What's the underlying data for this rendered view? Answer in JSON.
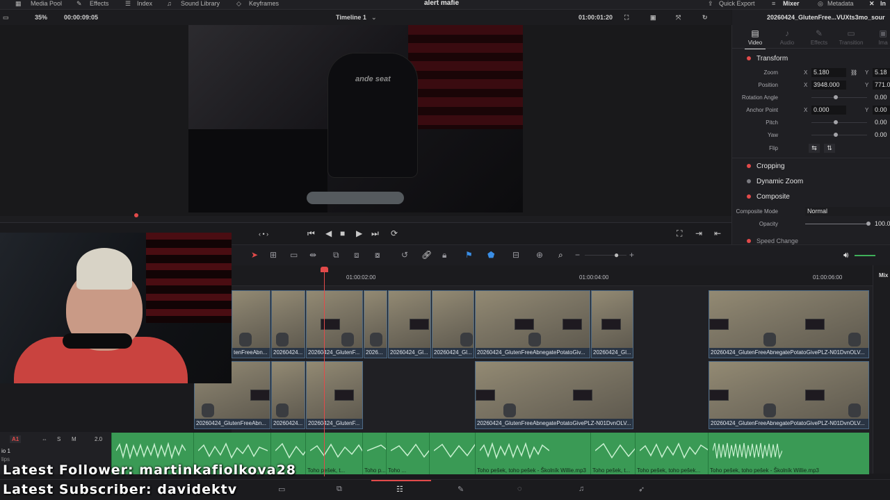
{
  "topbar": {
    "media_pool": "Media Pool",
    "effects": "Effects",
    "index": "Index",
    "sound_library": "Sound Library",
    "keyframes": "Keyframes",
    "project_title": "alert mafie",
    "quick_export": "Quick Export",
    "mixer": "Mixer",
    "metadata": "Metadata",
    "inspector_abbrev": "In"
  },
  "viewer_bar": {
    "zoom": "35%",
    "source_timecode": "00:00:09:05",
    "timeline_name": "Timeline 1",
    "record_timecode": "01:00:01:20"
  },
  "inspector": {
    "clip_name": "20260424_GlutenFree...VUXts3mo_sour",
    "tabs": [
      {
        "label": "Video",
        "icon": "video-icon",
        "active": true
      },
      {
        "label": "Audio",
        "icon": "audio-icon",
        "active": false
      },
      {
        "label": "Effects",
        "icon": "effects-icon",
        "active": false
      },
      {
        "label": "Transition",
        "icon": "transition-icon",
        "active": false
      },
      {
        "label": "Ima",
        "icon": "image-icon",
        "active": false
      }
    ],
    "transform_label": "Transform",
    "zoom_label": "Zoom",
    "zoom_x": "5.180",
    "zoom_y": "5.18",
    "position_label": "Position",
    "position_x": "3948.000",
    "position_y": "771.0",
    "rotation_label": "Rotation Angle",
    "rotation_val": "0.00",
    "anchor_label": "Anchor Point",
    "anchor_x": "0.000",
    "anchor_y": "0.00",
    "pitch_label": "Pitch",
    "pitch_val": "0.00",
    "yaw_label": "Yaw",
    "yaw_val": "0.00",
    "flip_label": "Flip",
    "axis_x": "X",
    "axis_y": "Y",
    "cropping_label": "Cropping",
    "dynamic_zoom_label": "Dynamic Zoom",
    "composite_label": "Composite",
    "composite_mode_label": "Composite Mode",
    "composite_mode_val": "Normal",
    "opacity_label": "Opacity",
    "opacity_val": "100.0",
    "speed_change_label": "Speed Change"
  },
  "timeline": {
    "ruler_labels": [
      "01:00:02:00",
      "01:00:04:00",
      "01:00:06:00"
    ],
    "v2_clips": [
      "tenFreeAbn...",
      "20260424...",
      "20260424_GlutenF...",
      "2026...",
      "20260424_Gl...",
      "20260424_Gl...",
      "20260424_GlutenFreeAbnegatePotatoGiv...",
      "20260424_Gl...",
      "20260424_GlutenFreeAbnegatePotatoGivePLZ-N01DvnOLV..."
    ],
    "v1_clips": [
      "20260424_GlutenFreeAbn...",
      "20260424...",
      "20260424_GlutenF...",
      "20260424_GlutenFreeAbnegatePotatoGivePLZ-N01DvnOLV...",
      "20260424_GlutenFreeAbnegatePotatoGivePLZ-N01DvnOLV..."
    ],
    "audio_clips": [
      "",
      "",
      "",
      "Toho pešek, t...",
      "Toho p...",
      "Toho ...",
      "",
      "Toho pešek, toho pešek - Školník Willie.mp3",
      "Toho pešek, t...",
      "Toho pešek, toho pešek...",
      "Toho pešek, toho pešek - Školník Willie.mp3"
    ],
    "audio_track_label": "A1",
    "audio_level": "2.0",
    "audio_track_name": "io 1",
    "audio_sub": "lips",
    "mixer_label": "Mix"
  },
  "stream_overlay": {
    "follower": "Latest Follower: martinkafiolkova28",
    "subscriber": "Latest Subscriber: davidektv"
  },
  "colors": {
    "accent_red": "#e24a4a",
    "clip_border": "#4d6a86",
    "audio_green": "#3a9a55",
    "link_blue": "#3a8ee6"
  }
}
